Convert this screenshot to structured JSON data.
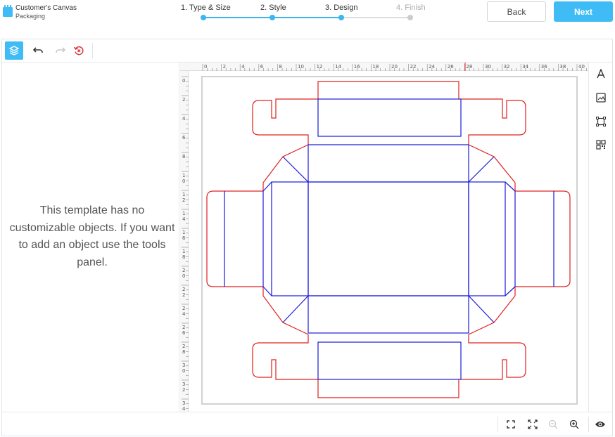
{
  "brand": {
    "title": "Customer's Canvas",
    "subtitle": "Packaging"
  },
  "steps": [
    {
      "label": "1. Type & Size",
      "state": "done"
    },
    {
      "label": "2. Style",
      "state": "done"
    },
    {
      "label": "3. Design",
      "state": "active"
    },
    {
      "label": "4. Finish",
      "state": "inactive"
    }
  ],
  "nav": {
    "back_label": "Back",
    "next_label": "Next"
  },
  "colors": {
    "accent": "#3fbcf5",
    "cut_line": "#e02020",
    "fold_line": "#1a1adb"
  },
  "toolbar": {
    "icons": [
      "layers-icon",
      "undo-icon",
      "redo-icon",
      "revert-icon"
    ]
  },
  "left_panel": {
    "message": "This template has no customizable objects. If you want to add an object use the tools panel."
  },
  "ruler": {
    "top_labels": [
      "0",
      "2",
      "4",
      "6",
      "8",
      "10",
      "12",
      "14",
      "16",
      "18",
      "20",
      "22",
      "24",
      "26",
      "28",
      "30",
      "32",
      "34",
      "36",
      "38",
      "40"
    ],
    "left_labels": [
      "0",
      "2",
      "4",
      "6",
      "8",
      "10",
      "12",
      "14",
      "16",
      "18",
      "20",
      "22",
      "24",
      "26",
      "28",
      "30",
      "32",
      "34"
    ]
  },
  "right_tools": [
    "text-tool-icon",
    "image-tool-icon",
    "shape-tool-icon",
    "qr-code-tool-icon"
  ],
  "bottom_tools": [
    "fit-to-screen-icon",
    "fullscreen-icon",
    "zoom-out-icon",
    "zoom-in-icon",
    "preview-icon"
  ]
}
